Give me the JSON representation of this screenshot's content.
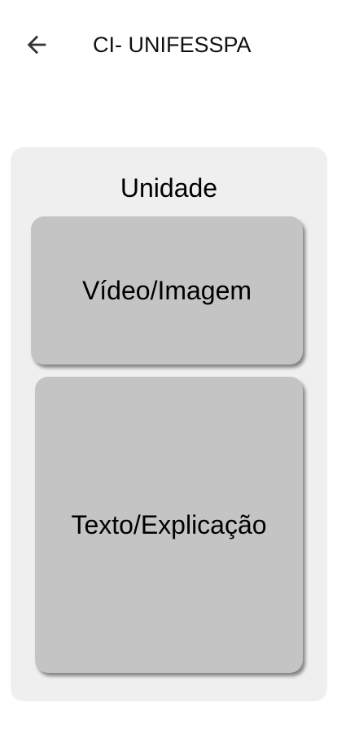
{
  "header": {
    "title": "CI- UNIFESSPA",
    "back_icon": "arrow-left-icon"
  },
  "panel": {
    "heading": "Unidade",
    "cards": [
      {
        "label": "Vídeo/Imagem"
      },
      {
        "label": "Texto/Explicação"
      }
    ]
  }
}
